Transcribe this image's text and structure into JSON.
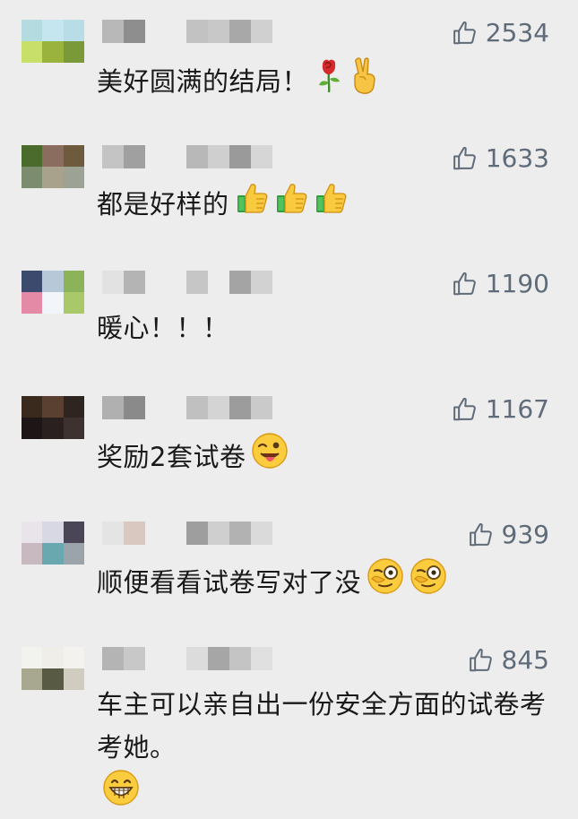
{
  "comments": [
    {
      "avatar_colors": [
        "#b4dbe0",
        "#c5e6ee",
        "#b9dde6",
        "#c8e06a",
        "#9ab33c",
        "#7a9a3a"
      ],
      "name_colors": [
        "#b8b8b8",
        "#8e8e8e",
        "#c2c2c2",
        "#c8c8c8",
        "#a8a8a8",
        "#d0d0d0"
      ],
      "likes": "2534",
      "text": "美好圆满的结局！",
      "emojis": [
        "rose-icon",
        "victory-hand-icon"
      ]
    },
    {
      "avatar_colors": [
        "#4b6b2c",
        "#8a6d5e",
        "#6e5b3e",
        "#7c8c6e",
        "#a8a28c",
        "#9ca294"
      ],
      "name_colors": [
        "#c4c4c4",
        "#a0a0a0",
        "#b8b8b8",
        "#cfcfcf",
        "#9a9a9a",
        "#d6d6d6"
      ],
      "likes": "1633",
      "text": "都是好样的",
      "emojis": [
        "thumbs-up-icon",
        "thumbs-up-icon",
        "thumbs-up-icon"
      ]
    },
    {
      "avatar_colors": [
        "#3c4a6e",
        "#b7c8d8",
        "#8db35a",
        "#e58aa6",
        "#f2f6fa",
        "#a8c86a"
      ],
      "name_colors": [
        "#e2e2e2",
        "#b4b4b4",
        "#c6c6c6",
        "#ededed",
        "#a4a4a4",
        "#d2d2d2"
      ],
      "likes": "1190",
      "text": "暖心！！！",
      "emojis": []
    },
    {
      "avatar_colors": [
        "#3a2a1e",
        "#5a4030",
        "#2e2420",
        "#1e1616",
        "#2a2020",
        "#3e3230"
      ],
      "name_colors": [
        "#b0b0b0",
        "#8a8a8a",
        "#c0c0c0",
        "#d4d4d4",
        "#9c9c9c",
        "#cacaca"
      ],
      "likes": "1167",
      "text": "奖励2套试卷",
      "emojis": [
        "winking-tongue-face-icon"
      ]
    },
    {
      "avatar_colors": [
        "#e8e4ea",
        "#d8d8e4",
        "#4a4658",
        "#c8b8c0",
        "#6aa8b0",
        "#9aa4aa"
      ],
      "name_colors": [
        "#e4e4e4",
        "#d8c8c0",
        "#9e9e9e",
        "#cfcfcf",
        "#b2b2b2",
        "#dadada"
      ],
      "likes": "939",
      "text": "顺便看看试卷写对了没",
      "emojis": [
        "monocle-face-icon",
        "monocle-face-icon"
      ]
    },
    {
      "avatar_colors": [
        "#f2f2ee",
        "#f0eee8",
        "#f4f2ee",
        "#a8a890",
        "#585a44",
        "#d0ccc0"
      ],
      "name_colors": [
        "#b4b4b4",
        "#c8c8c8",
        "#dcdcdc",
        "#a6a6a6",
        "#c4c4c4",
        "#e0e0e0"
      ],
      "likes": "845",
      "text": "车主可以亲自出一份安全方面的试卷考考她。",
      "emojis": [
        "grinning-face-icon"
      ]
    }
  ],
  "colors": {
    "background": "#ededed",
    "like_gray": "#5f6b78",
    "text": "#191919"
  }
}
